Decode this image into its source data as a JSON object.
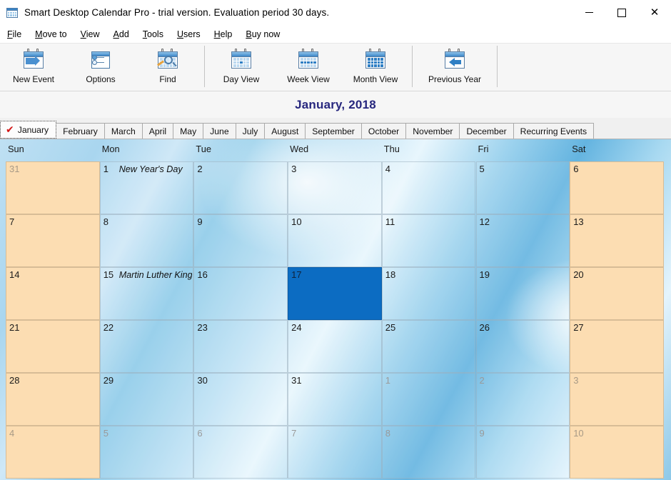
{
  "window": {
    "title": "Smart Desktop Calendar Pro - trial version. Evaluation period 30 days.",
    "icon": "calendar-icon",
    "controls": {
      "minimize": "–",
      "maximize": "□",
      "close": "✕"
    }
  },
  "menu": {
    "items": [
      {
        "label": "File",
        "accel": "F"
      },
      {
        "label": "Move to",
        "accel": "M"
      },
      {
        "label": "View",
        "accel": "V"
      },
      {
        "label": "Add",
        "accel": "A"
      },
      {
        "label": "Tools",
        "accel": "T"
      },
      {
        "label": "Users",
        "accel": "U"
      },
      {
        "label": "Help",
        "accel": "H"
      },
      {
        "label": "Buy now",
        "accel": "B"
      }
    ]
  },
  "toolbar": {
    "groups": [
      {
        "buttons": [
          {
            "label": "New Event",
            "icon": "new-event-icon"
          },
          {
            "label": "Options",
            "icon": "options-icon"
          },
          {
            "label": "Find",
            "icon": "find-icon"
          }
        ]
      },
      {
        "buttons": [
          {
            "label": "Day View",
            "icon": "day-view-icon"
          },
          {
            "label": "Week View",
            "icon": "week-view-icon"
          },
          {
            "label": "Month View",
            "icon": "month-view-icon"
          }
        ]
      },
      {
        "buttons": [
          {
            "label": "Previous Year",
            "icon": "previous-year-icon"
          }
        ]
      }
    ]
  },
  "month_title": "January, 2018",
  "tabs": {
    "active_index": 0,
    "check_glyph": "✔",
    "items": [
      {
        "label": "January"
      },
      {
        "label": "February"
      },
      {
        "label": "March"
      },
      {
        "label": "April"
      },
      {
        "label": "May"
      },
      {
        "label": "June"
      },
      {
        "label": "July"
      },
      {
        "label": "August"
      },
      {
        "label": "September"
      },
      {
        "label": "October"
      },
      {
        "label": "November"
      },
      {
        "label": "December"
      },
      {
        "label": "Recurring Events"
      }
    ]
  },
  "calendar": {
    "day_headers": [
      "Sun",
      "Mon",
      "Tue",
      "Wed",
      "Thu",
      "Fri",
      "Sat"
    ],
    "selected_day": 17,
    "colors": {
      "weekend_fill": "#fcddb2",
      "selection_fill": "#0c6cc2",
      "title_text": "#27277e",
      "check_mark": "#d21616"
    },
    "weeks": [
      [
        {
          "num": "31",
          "other": true,
          "weekend": true,
          "event": ""
        },
        {
          "num": "1",
          "other": false,
          "weekend": false,
          "event": "New Year's Day"
        },
        {
          "num": "2",
          "other": false,
          "weekend": false,
          "event": ""
        },
        {
          "num": "3",
          "other": false,
          "weekend": false,
          "event": ""
        },
        {
          "num": "4",
          "other": false,
          "weekend": false,
          "event": ""
        },
        {
          "num": "5",
          "other": false,
          "weekend": false,
          "event": ""
        },
        {
          "num": "6",
          "other": false,
          "weekend": true,
          "event": ""
        }
      ],
      [
        {
          "num": "7",
          "other": false,
          "weekend": true,
          "event": ""
        },
        {
          "num": "8",
          "other": false,
          "weekend": false,
          "event": ""
        },
        {
          "num": "9",
          "other": false,
          "weekend": false,
          "event": ""
        },
        {
          "num": "10",
          "other": false,
          "weekend": false,
          "event": ""
        },
        {
          "num": "11",
          "other": false,
          "weekend": false,
          "event": ""
        },
        {
          "num": "12",
          "other": false,
          "weekend": false,
          "event": ""
        },
        {
          "num": "13",
          "other": false,
          "weekend": true,
          "event": ""
        }
      ],
      [
        {
          "num": "14",
          "other": false,
          "weekend": true,
          "event": ""
        },
        {
          "num": "15",
          "other": false,
          "weekend": false,
          "event": "Martin Luther King Day"
        },
        {
          "num": "16",
          "other": false,
          "weekend": false,
          "event": ""
        },
        {
          "num": "17",
          "other": false,
          "weekend": false,
          "event": "",
          "selected": true
        },
        {
          "num": "18",
          "other": false,
          "weekend": false,
          "event": ""
        },
        {
          "num": "19",
          "other": false,
          "weekend": false,
          "event": ""
        },
        {
          "num": "20",
          "other": false,
          "weekend": true,
          "event": ""
        }
      ],
      [
        {
          "num": "21",
          "other": false,
          "weekend": true,
          "event": ""
        },
        {
          "num": "22",
          "other": false,
          "weekend": false,
          "event": ""
        },
        {
          "num": "23",
          "other": false,
          "weekend": false,
          "event": ""
        },
        {
          "num": "24",
          "other": false,
          "weekend": false,
          "event": ""
        },
        {
          "num": "25",
          "other": false,
          "weekend": false,
          "event": ""
        },
        {
          "num": "26",
          "other": false,
          "weekend": false,
          "event": ""
        },
        {
          "num": "27",
          "other": false,
          "weekend": true,
          "event": ""
        }
      ],
      [
        {
          "num": "28",
          "other": false,
          "weekend": true,
          "event": ""
        },
        {
          "num": "29",
          "other": false,
          "weekend": false,
          "event": ""
        },
        {
          "num": "30",
          "other": false,
          "weekend": false,
          "event": ""
        },
        {
          "num": "31",
          "other": false,
          "weekend": false,
          "event": ""
        },
        {
          "num": "1",
          "other": true,
          "weekend": false,
          "event": ""
        },
        {
          "num": "2",
          "other": true,
          "weekend": false,
          "event": ""
        },
        {
          "num": "3",
          "other": true,
          "weekend": true,
          "event": ""
        }
      ],
      [
        {
          "num": "4",
          "other": true,
          "weekend": true,
          "event": ""
        },
        {
          "num": "5",
          "other": true,
          "weekend": false,
          "event": ""
        },
        {
          "num": "6",
          "other": true,
          "weekend": false,
          "event": ""
        },
        {
          "num": "7",
          "other": true,
          "weekend": false,
          "event": ""
        },
        {
          "num": "8",
          "other": true,
          "weekend": false,
          "event": ""
        },
        {
          "num": "9",
          "other": true,
          "weekend": false,
          "event": ""
        },
        {
          "num": "10",
          "other": true,
          "weekend": true,
          "event": ""
        }
      ]
    ]
  }
}
